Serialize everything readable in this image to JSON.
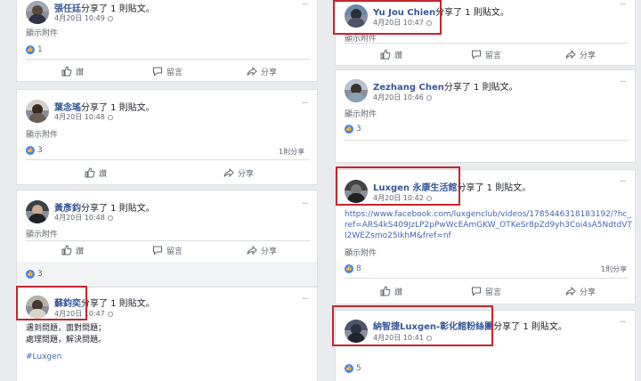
{
  "ui": {
    "shared_post": "分享了 1 則貼文。",
    "show_attachments": "顯示附件",
    "like": "讚",
    "comment": "留言",
    "share": "分享",
    "more": "···"
  },
  "colors": {
    "accent": "#4267b2",
    "like_badge": "#4080ff",
    "highlight": "#c8242d"
  },
  "posts": [
    {
      "name": "張任廷",
      "time": "4月20日 10:49",
      "likes": "1",
      "shares": ""
    },
    {
      "name": "葉念瑤",
      "time": "4月20日 10:48",
      "likes": "3",
      "shares": "1則分享"
    },
    {
      "name": "黃彥鈞",
      "time": "4月20日 10:48",
      "likes": "3",
      "shares": ""
    },
    {
      "name": "蘇鈞奕",
      "time": "4月20日 10:47",
      "likes": "",
      "shares": "",
      "body_lines": [
        "遇到問題，面對問題；",
        "處理問題，解決問題。"
      ],
      "hashtag": "#Luxgen"
    },
    {
      "name": "Yu Jou Chien",
      "time": "4月20日 10:47",
      "likes": "",
      "shares": ""
    },
    {
      "name": "Zezhang Chen",
      "time": "4月20日 10:46",
      "likes": "3",
      "shares": ""
    },
    {
      "name": "Luxgen 永康生活館",
      "time": "4月20日 10:42",
      "likes": "8",
      "shares": "1則分享",
      "link_text": "https://www.facebook.com/luxgenclub/videos/1785446318183192/?hc_ref=ARS4kS409JzLP2pPwWcEAmGKW_OTKeSr8pZd9yh3Coi4sA5NdtdVTI2WEZsmo25IkhM&fref=nf"
    },
    {
      "name": "納智捷Luxgen-彰化館粉絲團",
      "time": "4月20日 10:41",
      "likes": "5",
      "shares": ""
    }
  ]
}
